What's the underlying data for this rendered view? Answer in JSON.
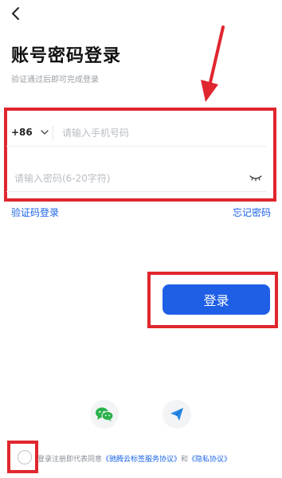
{
  "header": {
    "back_icon": "chevron-left-icon"
  },
  "page": {
    "title": "账号密码登录",
    "subtitle": "验证通过后即可完成登录"
  },
  "form": {
    "country_code": "+86",
    "phone_placeholder": "请输入手机号码",
    "password_placeholder": "请输入密码(6-20字符)",
    "eye_icon": "eye-closed-icon"
  },
  "links": {
    "sms_login": "验证码登录",
    "forgot_password": "忘记密码"
  },
  "login_button": {
    "label": "登录"
  },
  "social": {
    "wechat_icon": "wechat-icon",
    "send_icon": "paper-plane-icon"
  },
  "agreement": {
    "prefix": "登录注册即代表同意",
    "service_link": "《驰腾云标签服务协议》",
    "and": "和",
    "privacy_link": "《隐私协议》"
  },
  "colors": {
    "accent": "#1f5fe6",
    "link": "#1a64e8",
    "annotation_red": "#e0262e"
  }
}
